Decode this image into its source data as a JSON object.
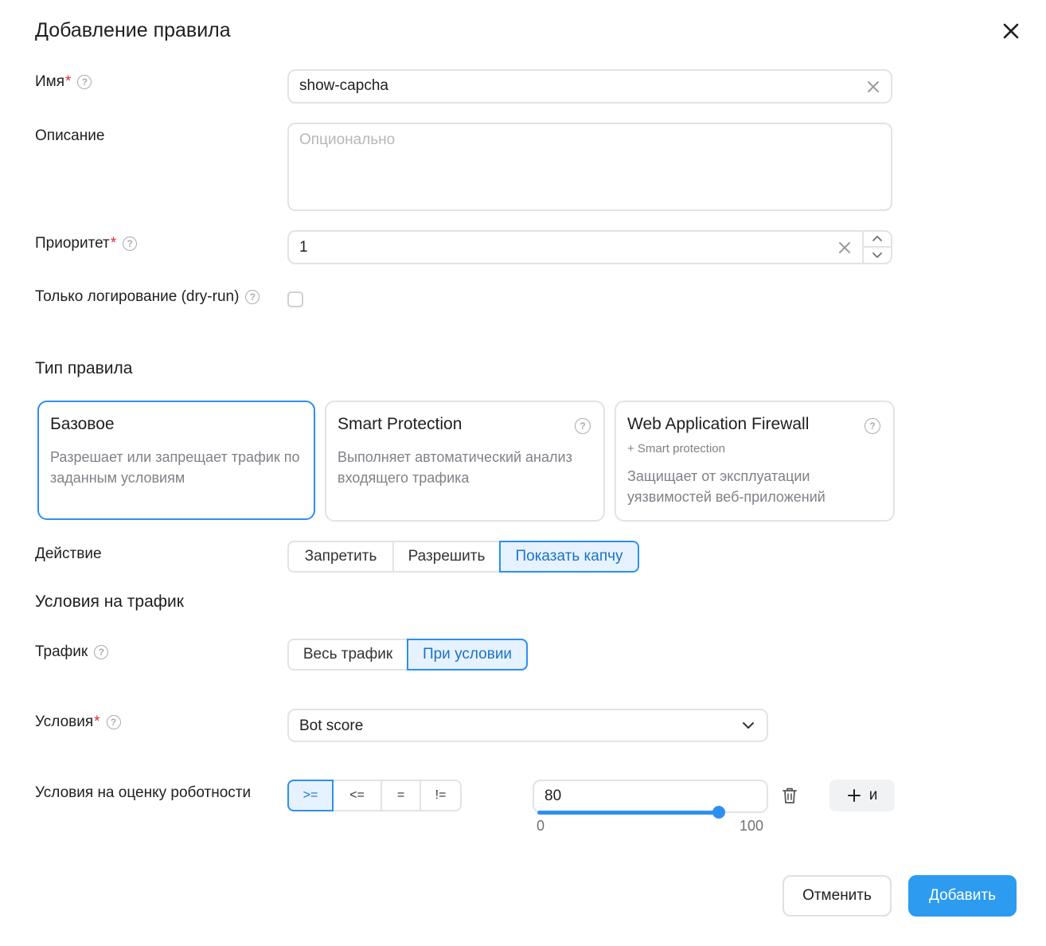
{
  "dialog": {
    "title": "Добавление правила"
  },
  "fields": {
    "name": {
      "label": "Имя",
      "required_mark": "*",
      "value": "show-capcha"
    },
    "description": {
      "label": "Описание",
      "placeholder": "Опционально"
    },
    "priority": {
      "label": "Приоритет",
      "required_mark": "*",
      "value": "1"
    },
    "dry_run": {
      "label": "Только логирование (dry-run)",
      "checked": false
    }
  },
  "help_glyph": "?",
  "rule_type": {
    "heading": "Тип правила",
    "cards": [
      {
        "title": "Базовое",
        "subtitle": "",
        "description": "Разрешает или запрещает трафик по заданным условиям",
        "selected": true
      },
      {
        "title": "Smart Protection",
        "subtitle": "",
        "description": "Выполняет автоматический анализ входящего трафика",
        "selected": false
      },
      {
        "title": "Web Application Firewall",
        "subtitle": "+ Smart protection",
        "description": "Защищает от эксплуатации уязвимостей веб-приложений",
        "selected": false
      }
    ]
  },
  "action": {
    "label": "Действие",
    "options": [
      "Запретить",
      "Разрешить",
      "Показать капчу"
    ],
    "selected": "Показать капчу"
  },
  "traffic_conditions": {
    "heading": "Условия на трафик"
  },
  "traffic": {
    "label": "Трафик",
    "options": [
      "Весь трафик",
      "При условии"
    ],
    "selected": "При условии"
  },
  "conditions": {
    "label": "Условия",
    "required_mark": "*",
    "value": "Bot score"
  },
  "bot_score": {
    "label": "Условия на оценку роботности",
    "operators": [
      ">=",
      "<=",
      "=",
      "!="
    ],
    "selected_operator": ">=",
    "value": "80",
    "min": "0",
    "max": "100",
    "level": 80
  },
  "buttons": {
    "add_and": "и",
    "cancel": "Отменить",
    "submit": "Добавить"
  },
  "colors": {
    "accent": "#2d8ff0",
    "required": "#e0283a",
    "primary_button": "#2d9bf0"
  }
}
